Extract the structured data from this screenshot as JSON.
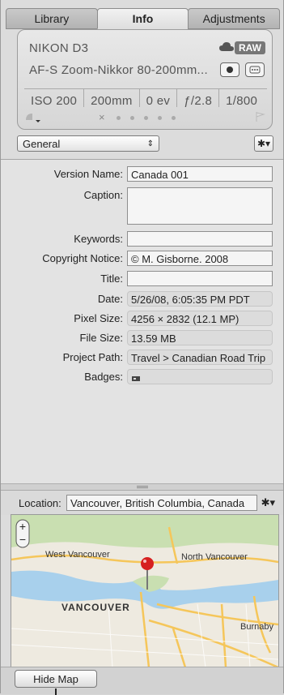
{
  "tabs": [
    {
      "label": "Library"
    },
    {
      "label": "Info"
    },
    {
      "label": "Adjustments"
    }
  ],
  "exif": {
    "camera": "NIKON D3",
    "lens": "AF-S Zoom-Nikkor 80-200mm...",
    "raw_badge": "RAW",
    "params": [
      "ISO 200",
      "200mm",
      "0 ev",
      "ƒ/2.8",
      "1/800"
    ],
    "rating_reject": "×",
    "rating_dots": 5
  },
  "view": {
    "selected": "General",
    "arrow": "⇕",
    "gear": "✱▾"
  },
  "fields": [
    {
      "label": "Version Name:",
      "value": "Canada 001",
      "kind": "edit"
    },
    {
      "label": "Caption:",
      "value": "",
      "kind": "edit"
    },
    {
      "label": "Keywords:",
      "value": "",
      "kind": "edit"
    },
    {
      "label": "Copyright Notice:",
      "value": "© M. Gisborne. 2008",
      "kind": "edit"
    },
    {
      "label": "Title:",
      "value": "",
      "kind": "edit"
    },
    {
      "label": "Date:",
      "value": "5/26/08, 6:05:35 PM PDT",
      "kind": "ro"
    },
    {
      "label": "Pixel Size:",
      "value": "4256 × 2832 (12.1 MP)",
      "kind": "ro"
    },
    {
      "label": "File Size:",
      "value": "13.59 MB",
      "kind": "ro"
    },
    {
      "label": "Project Path:",
      "value": "Travel > Canadian Road Trip",
      "kind": "ro"
    },
    {
      "label": "Badges:",
      "value": "",
      "kind": "ro"
    }
  ],
  "location": {
    "label": "Location:",
    "value": "Vancouver, British Columbia, Canada"
  },
  "map": {
    "labels": {
      "west_vancouver": "West Vancouver",
      "north_vancouver": "North Vancouver",
      "vancouver": "VANCOUVER",
      "burnaby": "Burnaby"
    },
    "zoom_in": "+",
    "zoom_out": "−",
    "water_color": "#a8d0ec",
    "land_color": "#eeeae0",
    "park_color": "#c9dfb1",
    "road_color": "#f5c65a",
    "pin_color": "#d62020"
  },
  "hide_map": "Hide Map"
}
